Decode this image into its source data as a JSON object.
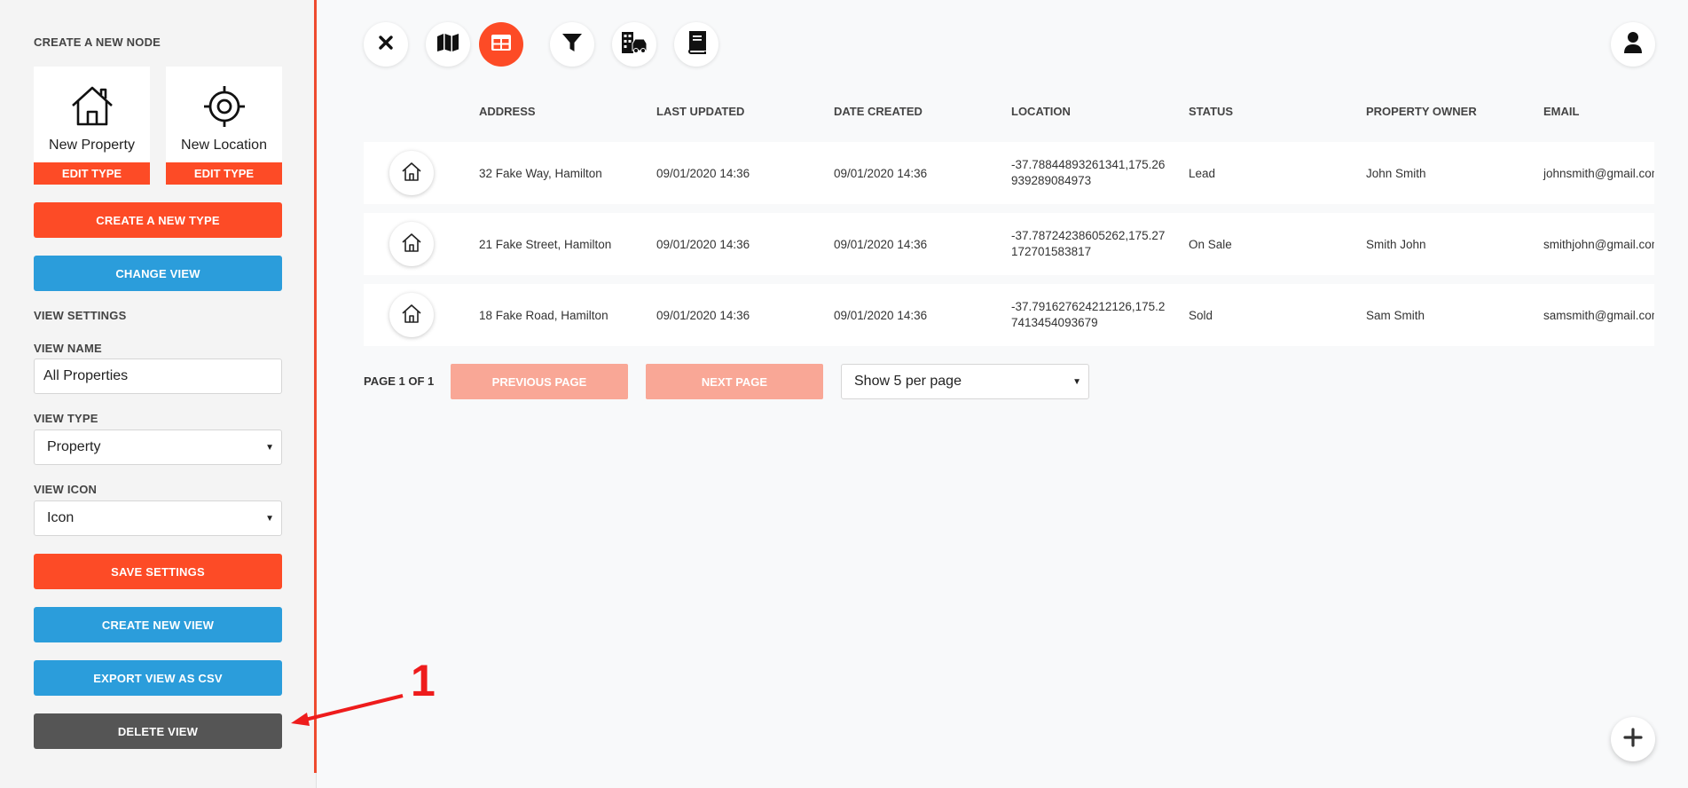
{
  "sidebar": {
    "create_node_heading": "CREATE A NEW NODE",
    "node_types": [
      {
        "label": "New Property",
        "icon": "house-icon",
        "edit_label": "EDIT TYPE"
      },
      {
        "label": "New Location",
        "icon": "crosshair-icon",
        "edit_label": "EDIT TYPE"
      }
    ],
    "create_type_label": "CREATE A NEW TYPE",
    "change_view_label": "CHANGE VIEW",
    "view_settings_heading": "VIEW SETTINGS",
    "view_name_label": "VIEW NAME",
    "view_name_value": "All Properties",
    "view_type_label": "VIEW TYPE",
    "view_type_value": "Property",
    "view_icon_label": "VIEW ICON",
    "view_icon_value": "Icon",
    "save_settings_label": "SAVE SETTINGS",
    "create_view_label": "CREATE NEW VIEW",
    "export_csv_label": "EXPORT VIEW AS CSV",
    "delete_view_label": "DELETE VIEW"
  },
  "toolbar": {
    "tools": [
      "close-icon",
      "map-icon",
      "table-icon",
      "filter-icon",
      "buildings-car-icon",
      "book-icon"
    ],
    "active_tool": "table-icon",
    "profile_icon": "user-icon"
  },
  "table": {
    "columns": [
      "ADDRESS",
      "LAST UPDATED",
      "DATE CREATED",
      "LOCATION",
      "STATUS",
      "PROPERTY OWNER",
      "EMAIL"
    ],
    "rows": [
      {
        "address": "32 Fake Way, Hamilton",
        "last_updated": "09/01/2020 14:36",
        "date_created": "09/01/2020 14:36",
        "location": "-37.78844893261341,175.26939289084973",
        "status": "Lead",
        "owner": "John Smith",
        "email": "johnsmith@gmail.com"
      },
      {
        "address": "21 Fake Street, Hamilton",
        "last_updated": "09/01/2020 14:36",
        "date_created": "09/01/2020 14:36",
        "location": "-37.78724238605262,175.27172701583817",
        "status": "On Sale",
        "owner": "Smith John",
        "email": "smithjohn@gmail.com"
      },
      {
        "address": "18 Fake Road, Hamilton",
        "last_updated": "09/01/2020 14:36",
        "date_created": "09/01/2020 14:36",
        "location": "-37.791627624212126,175.27413454093679",
        "status": "Sold",
        "owner": "Sam Smith",
        "email": "samsmith@gmail.com"
      }
    ]
  },
  "pagination": {
    "page_label": "PAGE 1 OF 1",
    "prev_label": "PREVIOUS PAGE",
    "next_label": "NEXT PAGE",
    "per_page_value": "Show 5 per page"
  },
  "annotation": {
    "number": "1"
  },
  "colors": {
    "accent": "#fd4b26",
    "blue": "#2b9ddb",
    "dark": "#555555",
    "annotation": "#ee1c1c"
  }
}
